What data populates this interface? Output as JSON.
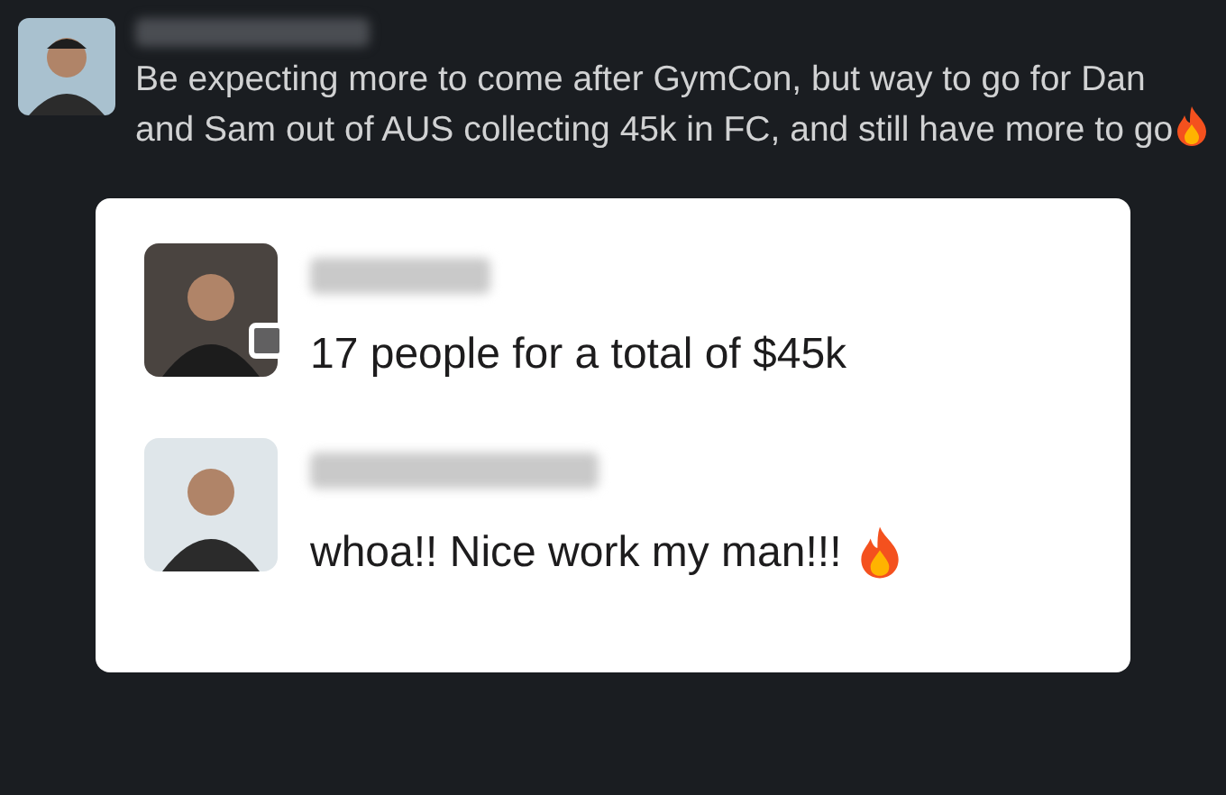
{
  "message": {
    "text": "Be expecting more to come after GymCon, but way to go for Dan and Sam out of AUS collecting 45k in FC, and still have more to go",
    "fire": true
  },
  "card": {
    "items": [
      {
        "text": "17 people for a total of $45k",
        "status_square": true,
        "fire": false
      },
      {
        "text": "whoa!! Nice work my man!!!",
        "status_square": false,
        "fire": true
      }
    ]
  }
}
